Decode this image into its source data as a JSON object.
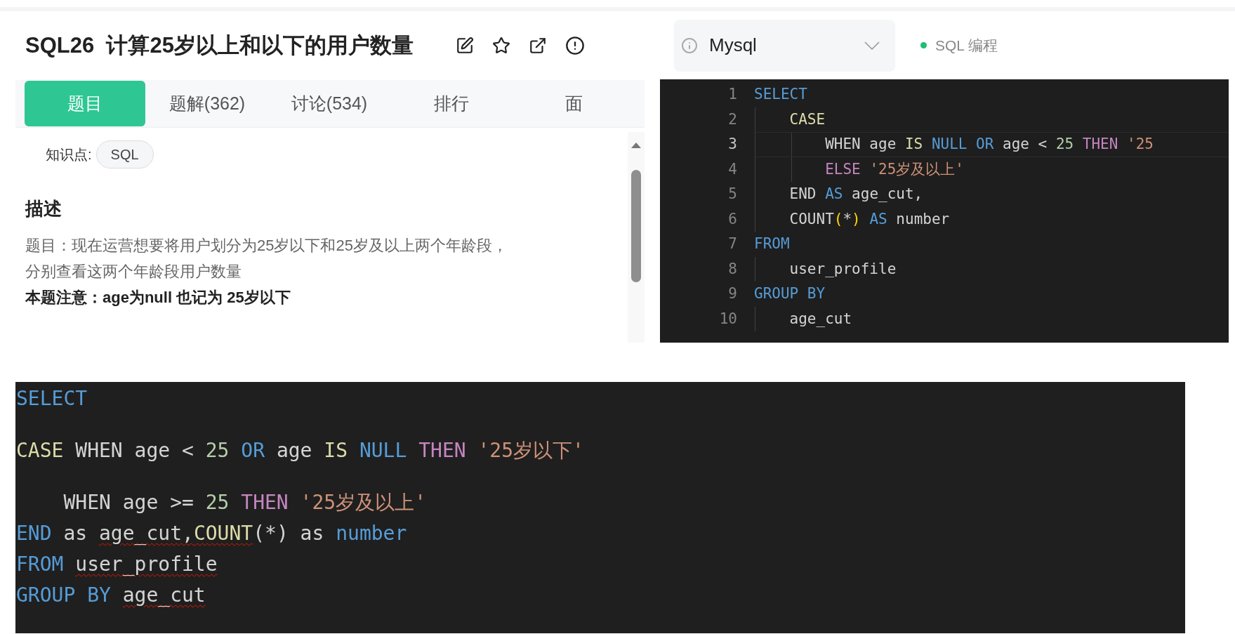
{
  "problem": {
    "title": "SQL26  计算25岁以上和以下的用户数量",
    "tabs": [
      {
        "label": "题目",
        "selected": true
      },
      {
        "label": "题解(362)",
        "selected": false
      },
      {
        "label": "讨论(534)",
        "selected": false
      },
      {
        "label": "排行",
        "selected": false
      },
      {
        "label": "面",
        "selected": false
      }
    ],
    "knowledge": {
      "label": "知识点:",
      "tags": [
        "SQL"
      ]
    },
    "description": {
      "heading": "描述",
      "lines": [
        "题目：现在运营想要将用户划分为25岁以下和25岁及以上两个年龄段，",
        "分别查看这两个年龄段用户数量"
      ],
      "note": "本题注意：age为null 也记为 25岁以下"
    }
  },
  "editor": {
    "language": "Mysql",
    "mode": "SQL 编程",
    "lines": [
      {
        "number": "1",
        "active": false,
        "tokens": [
          {
            "kind": "keyword",
            "text": "SELECT"
          }
        ]
      },
      {
        "number": "2",
        "active": false,
        "tokens": [
          {
            "kind": "func",
            "text": "    CASE"
          }
        ]
      },
      {
        "number": "3",
        "active": true,
        "tokens": [
          {
            "kind": "plain",
            "text": "        WHEN age "
          },
          {
            "kind": "func",
            "text": "IS "
          },
          {
            "kind": "keyword",
            "text": "NULL OR "
          },
          {
            "kind": "plain",
            "text": "age < "
          },
          {
            "kind": "number",
            "text": "25 "
          },
          {
            "kind": "control",
            "text": "THEN "
          },
          {
            "kind": "string",
            "text": "'25"
          }
        ]
      },
      {
        "number": "4",
        "active": false,
        "tokens": [
          {
            "kind": "control",
            "text": "        ELSE "
          },
          {
            "kind": "string",
            "text": "'25岁及以上'"
          }
        ]
      },
      {
        "number": "5",
        "active": false,
        "tokens": [
          {
            "kind": "plain",
            "text": "    END "
          },
          {
            "kind": "keyword",
            "text": "AS "
          },
          {
            "kind": "plain",
            "text": "age_cut,"
          }
        ]
      },
      {
        "number": "6",
        "active": false,
        "tokens": [
          {
            "kind": "plain",
            "text": "    COUNT"
          },
          {
            "kind": "paren",
            "text": "("
          },
          {
            "kind": "plain",
            "text": "*"
          },
          {
            "kind": "paren",
            "text": ") "
          },
          {
            "kind": "keyword",
            "text": "AS "
          },
          {
            "kind": "plain",
            "text": "number"
          }
        ]
      },
      {
        "number": "7",
        "active": false,
        "tokens": [
          {
            "kind": "keyword",
            "text": "FROM"
          }
        ]
      },
      {
        "number": "8",
        "active": false,
        "tokens": [
          {
            "kind": "plain",
            "text": "    user_profile"
          }
        ]
      },
      {
        "number": "9",
        "active": false,
        "tokens": [
          {
            "kind": "keyword",
            "text": "GROUP BY"
          }
        ]
      },
      {
        "number": "10",
        "active": false,
        "tokens": [
          {
            "kind": "plain",
            "text": "    age_cut"
          }
        ]
      }
    ]
  },
  "snippet": {
    "lines": [
      {
        "spaced": false,
        "tokens": [
          {
            "kind": "keyword",
            "text": "SELECT",
            "squiggle": false
          }
        ]
      },
      {
        "spaced": true,
        "tokens": [
          {
            "kind": "func",
            "text": "CASE ",
            "squiggle": false
          },
          {
            "kind": "plain",
            "text": "WHEN age < ",
            "squiggle": false
          },
          {
            "kind": "number",
            "text": "25 ",
            "squiggle": false
          },
          {
            "kind": "keyword",
            "text": "OR ",
            "squiggle": false
          },
          {
            "kind": "plain",
            "text": "age ",
            "squiggle": false
          },
          {
            "kind": "func",
            "text": "IS ",
            "squiggle": false
          },
          {
            "kind": "keyword",
            "text": "NULL ",
            "squiggle": false
          },
          {
            "kind": "control",
            "text": "THEN ",
            "squiggle": false
          },
          {
            "kind": "string",
            "text": "'25岁以下'",
            "squiggle": false
          }
        ]
      },
      {
        "spaced": true,
        "tokens": [
          {
            "kind": "plain",
            "text": "    WHEN age >= ",
            "squiggle": false
          },
          {
            "kind": "number",
            "text": "25 ",
            "squiggle": false
          },
          {
            "kind": "control",
            "text": "THEN ",
            "squiggle": false
          },
          {
            "kind": "string",
            "text": "'25岁及以上'",
            "squiggle": false
          }
        ]
      },
      {
        "spaced": false,
        "tokens": [
          {
            "kind": "keyword",
            "text": "END ",
            "squiggle": false
          },
          {
            "kind": "plain",
            "text": "as ",
            "squiggle": false
          },
          {
            "kind": "plain",
            "text": "age_cut,",
            "squiggle": true
          },
          {
            "kind": "func",
            "text": "COUNT",
            "squiggle": true
          },
          {
            "kind": "plain",
            "text": "(*) as ",
            "squiggle": false
          },
          {
            "kind": "keyword",
            "text": "number",
            "squiggle": false
          }
        ]
      },
      {
        "spaced": false,
        "tokens": [
          {
            "kind": "keyword",
            "text": "FROM ",
            "squiggle": false
          },
          {
            "kind": "plain",
            "text": "user_profile",
            "squiggle": true
          }
        ]
      },
      {
        "spaced": false,
        "tokens": [
          {
            "kind": "keyword",
            "text": "GROUP BY ",
            "squiggle": false
          },
          {
            "kind": "plain",
            "text": "age_cut",
            "squiggle": true
          }
        ]
      }
    ]
  }
}
